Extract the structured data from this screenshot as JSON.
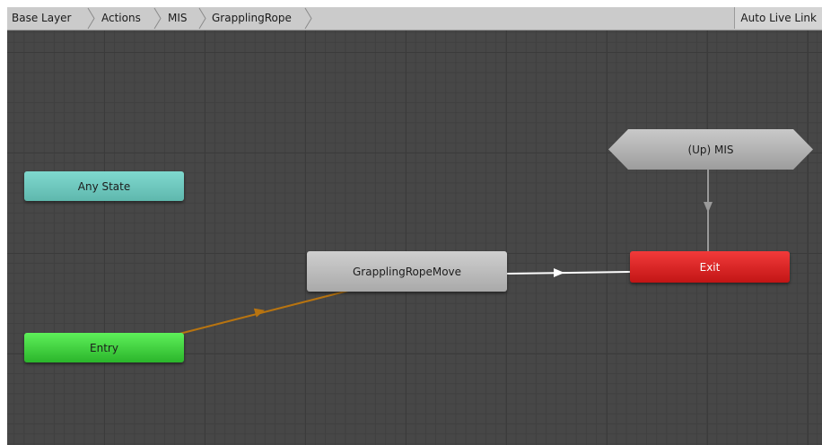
{
  "breadcrumb": [
    {
      "label": "Base Layer"
    },
    {
      "label": "Actions"
    },
    {
      "label": "MIS"
    },
    {
      "label": "GrapplingRope"
    }
  ],
  "toolbar": {
    "live_link_label": "Auto Live Link"
  },
  "graph": {
    "nodes": {
      "any_state": "Any State",
      "entry": "Entry",
      "grappling_rope_move": "GrapplingRopeMove",
      "exit": "Exit",
      "up_mis": "(Up) MIS"
    },
    "transitions": [
      {
        "from": "Entry",
        "to": "GrapplingRopeMove",
        "type": "default",
        "color": "#b87410"
      },
      {
        "from": "GrapplingRopeMove",
        "to": "Exit",
        "type": "normal",
        "color": "#ffffff"
      },
      {
        "from": "(Up) MIS",
        "to": "Exit",
        "type": "normal",
        "color": "#9a9a9a"
      }
    ]
  },
  "colors": {
    "any_state": "#6fc9be",
    "entry": "#3cd43a",
    "exit": "#e02222",
    "state_default": "#bdbdbd",
    "graph_background": "#474747",
    "toolbar": "#cbcbcb"
  }
}
